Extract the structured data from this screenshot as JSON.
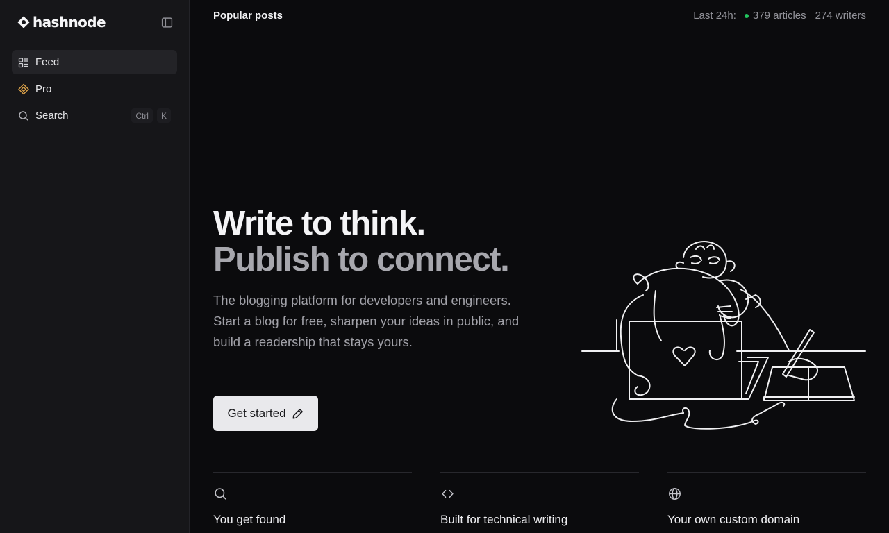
{
  "brand": {
    "name": "hashnode"
  },
  "sidebar": {
    "items": [
      {
        "label": "Feed",
        "icon": "feed-icon",
        "active": true
      },
      {
        "label": "Pro",
        "icon": "pro-icon",
        "active": false
      },
      {
        "label": "Search",
        "icon": "search-icon",
        "active": false,
        "shortcut": [
          "Ctrl",
          "K"
        ]
      }
    ]
  },
  "topbar": {
    "title": "Popular posts",
    "stats_label": "Last 24h:",
    "articles": "379 articles",
    "writers": "274 writers"
  },
  "hero": {
    "line1": "Write to think.",
    "line2": "Publish to connect.",
    "subtitle": "The blogging platform for developers and engineers. Start a blog for free, sharpen your ideas in public, and build a readership that stays yours.",
    "cta_label": "Get started"
  },
  "features": [
    {
      "title": "You get found",
      "icon": "search-icon"
    },
    {
      "title": "Built for technical writing",
      "icon": "code-icon"
    },
    {
      "title": "Your own custom domain",
      "icon": "globe-icon"
    }
  ],
  "colors": {
    "background": "#0b0b0d",
    "sidebar": "#161619",
    "accent_green": "#22c55e",
    "pro_accent": "#e0a54a",
    "cta_bg": "#e9e9ec"
  }
}
